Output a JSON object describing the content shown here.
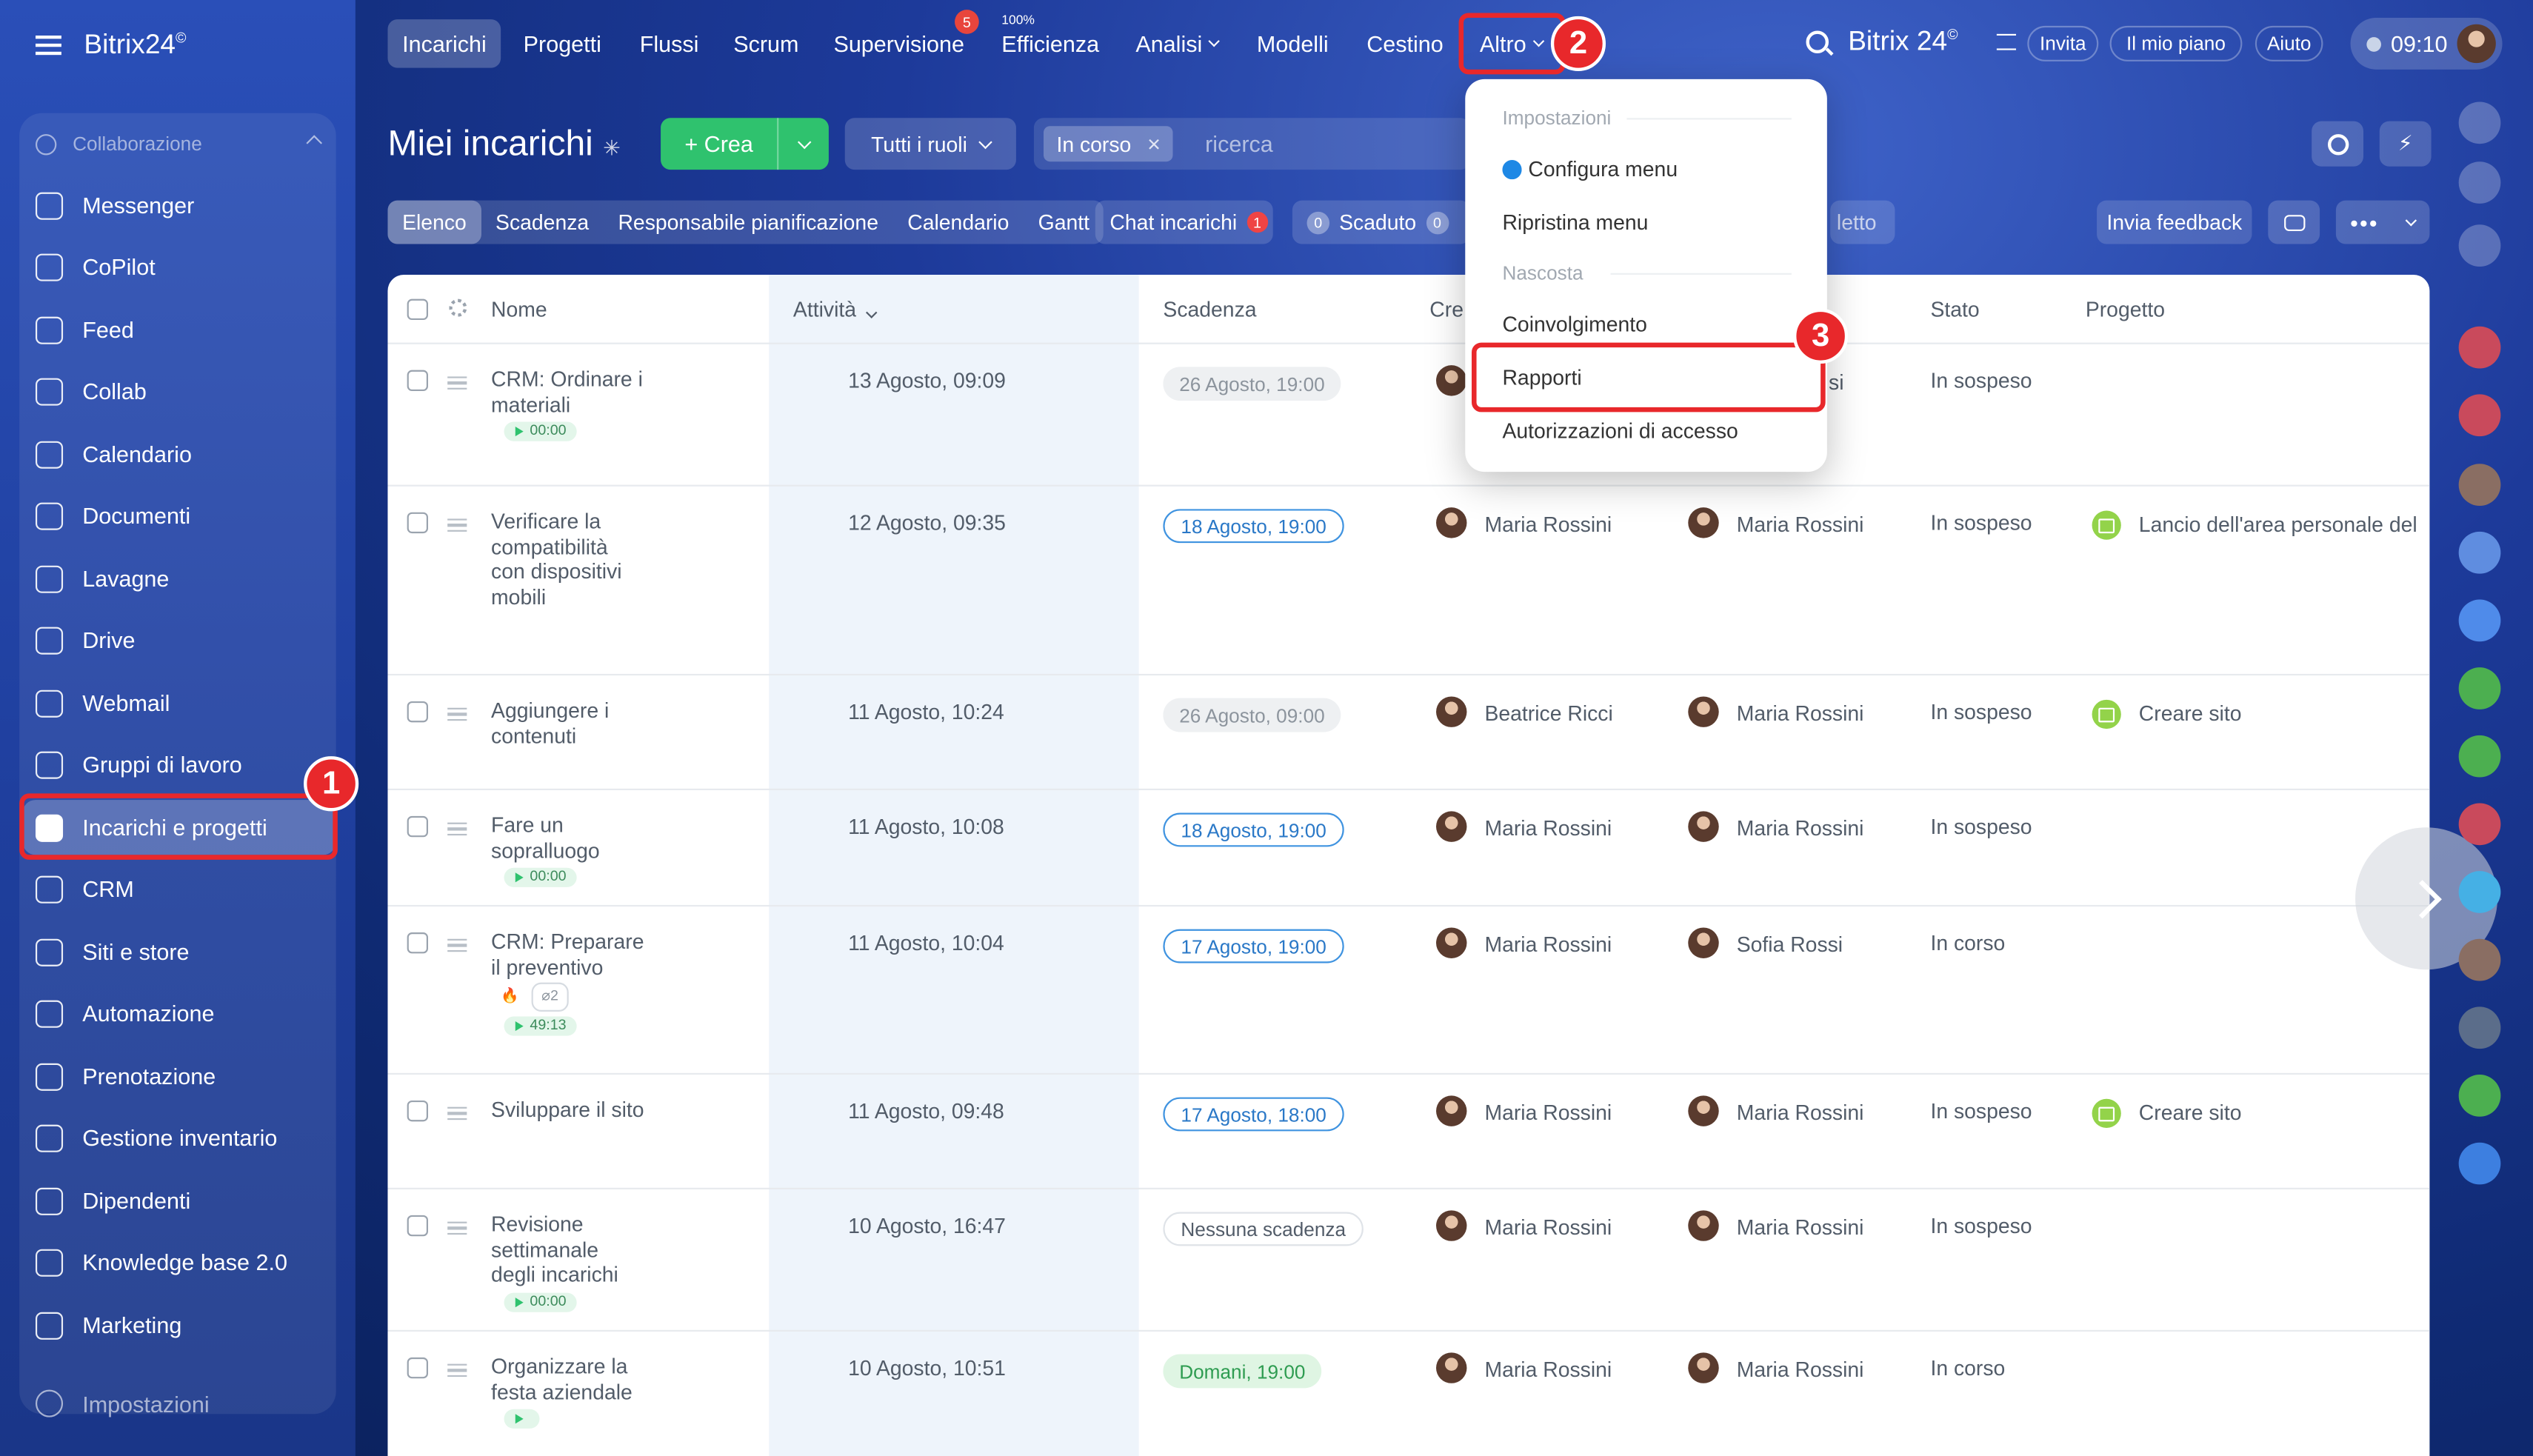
{
  "app": {
    "logo": "Bitrix24",
    "logo_sup": "©"
  },
  "sidebar": {
    "group_label": "Collaborazione",
    "items": [
      {
        "label": "Messenger",
        "icon": "chat-icon"
      },
      {
        "label": "CoPilot",
        "icon": "copilot-icon"
      },
      {
        "label": "Feed",
        "icon": "feed-icon"
      },
      {
        "label": "Collab",
        "icon": "collab-icon"
      },
      {
        "label": "Calendario",
        "icon": "calendar-icon"
      },
      {
        "label": "Documenti",
        "icon": "document-icon"
      },
      {
        "label": "Lavagne",
        "icon": "board-icon"
      },
      {
        "label": "Drive",
        "icon": "drive-icon"
      },
      {
        "label": "Webmail",
        "icon": "mail-icon"
      },
      {
        "label": "Gruppi di lavoro",
        "icon": "group-icon"
      },
      {
        "label": "Incarichi e progetti",
        "icon": "task-check-icon",
        "active": true
      },
      {
        "label": "CRM",
        "icon": "crm-icon"
      },
      {
        "label": "Siti e store",
        "icon": "cart-icon"
      },
      {
        "label": "Automazione",
        "icon": "automation-icon"
      },
      {
        "label": "Prenotazione",
        "icon": "booking-icon"
      },
      {
        "label": "Gestione inventario",
        "icon": "inventory-icon"
      },
      {
        "label": "Dipendenti",
        "icon": "employees-icon"
      },
      {
        "label": "Knowledge base 2.0",
        "icon": "books-icon"
      },
      {
        "label": "Marketing",
        "icon": "marketing-icon"
      }
    ],
    "settings_label": "Impostazioni"
  },
  "topbar": {
    "nav": [
      {
        "label": "Incarichi",
        "active": true
      },
      {
        "label": "Progetti"
      },
      {
        "label": "Flussi"
      },
      {
        "label": "Scrum"
      },
      {
        "label": "Supervisione",
        "badge": "5"
      },
      {
        "label": "Efficienza",
        "pct": "100%"
      },
      {
        "label": "Analisi",
        "dropdown": true
      },
      {
        "label": "Modelli"
      },
      {
        "label": "Cestino"
      },
      {
        "label": "Altro",
        "dropdown": true
      }
    ],
    "brand": "Bitrix 24",
    "invite": "Invita",
    "plan": "Il mio piano",
    "help": "Aiuto",
    "clock": "09:10"
  },
  "page": {
    "title": "Miei incarichi",
    "create": "Crea",
    "roles": "Tutti i ruoli",
    "filter_chip": "In corso",
    "search_placeholder": "ricerca",
    "tabs": [
      "Elenco",
      "Scadenza",
      "Responsabile pianificazione",
      "Calendario",
      "Gantt"
    ],
    "chat_tab": "Chat incarichi",
    "chat_count": "1",
    "overdue_count": "0",
    "overdue": "Scaduto",
    "overdue_count2": "0",
    "hidden_tab_tail": "letto",
    "feedback": "Invia feedback"
  },
  "table": {
    "headers": {
      "name": "Nome",
      "activity": "Attività",
      "deadline": "Scadenza",
      "creator": "Cre",
      "status": "Stato",
      "project": "Progetto"
    },
    "rows": [
      {
        "name": "CRM: Ordinare i materiali",
        "timer": "00:00",
        "activity": "13 Agosto, 09:09",
        "deadline": "26 Agosto, 19:00",
        "dl_style": "gray",
        "creator": "",
        "responsible": "si",
        "status": "In sospeso",
        "project": ""
      },
      {
        "name": "Verificare la compatibilità con dispositivi mobili",
        "activity": "12 Agosto, 09:35",
        "deadline": "18 Agosto, 19:00",
        "dl_style": "blue",
        "creator": "Maria Rossini",
        "responsible": "Maria Rossini",
        "status": "In sospeso",
        "project": "Lancio dell'area personale del"
      },
      {
        "name": "Aggiungere i contenuti",
        "activity": "11 Agosto, 10:24",
        "deadline": "26 Agosto, 09:00",
        "dl_style": "gray",
        "creator": "Beatrice Ricci",
        "responsible": "Maria Rossini",
        "status": "In sospeso",
        "project": "Creare sito"
      },
      {
        "name": "Fare un sopralluogo",
        "timer": "00:00",
        "activity": "11 Agosto, 10:08",
        "deadline": "18 Agosto, 19:00",
        "dl_style": "blue",
        "creator": "Maria Rossini",
        "responsible": "Maria Rossini",
        "status": "In sospeso",
        "project": ""
      },
      {
        "name": "CRM: Preparare il preventivo",
        "timer": "49:13",
        "attachments": "2",
        "activity": "11 Agosto, 10:04",
        "deadline": "17 Agosto, 19:00",
        "dl_style": "blue",
        "creator": "Maria Rossini",
        "responsible": "Sofia Rossi",
        "status": "In corso",
        "project": ""
      },
      {
        "name": "Sviluppare il sito",
        "activity": "11 Agosto, 09:48",
        "deadline": "17 Agosto, 18:00",
        "dl_style": "blue",
        "creator": "Maria Rossini",
        "responsible": "Maria Rossini",
        "status": "In sospeso",
        "project": "Creare sito"
      },
      {
        "name": "Revisione settimanale degli incarichi",
        "timer": "00:00",
        "activity": "10 Agosto, 16:47",
        "deadline": "Nessuna scadenza",
        "dl_style": "plain",
        "creator": "Maria Rossini",
        "responsible": "Maria Rossini",
        "status": "In sospeso",
        "project": ""
      },
      {
        "name": "Organizzare la festa aziendale",
        "timer": "",
        "activity": "10 Agosto, 10:51",
        "deadline": "Domani, 19:00",
        "dl_style": "green",
        "creator": "Maria Rossini",
        "responsible": "Maria Rossini",
        "status": "In corso",
        "project": ""
      }
    ]
  },
  "menu": {
    "section_settings": "Impostazioni",
    "configure": "Configura menu",
    "restore": "Ripristina menu",
    "section_hidden": "Nascosta",
    "engagement": "Coinvolgimento",
    "reports": "Rapporti",
    "access": "Autorizzazioni di accesso"
  },
  "annotations": {
    "step1": "1",
    "step2": "2",
    "step3": "3"
  },
  "colors": {
    "accent_green": "#2fc26e",
    "highlight_red": "#e8282b",
    "link_blue": "#2a78c7"
  }
}
